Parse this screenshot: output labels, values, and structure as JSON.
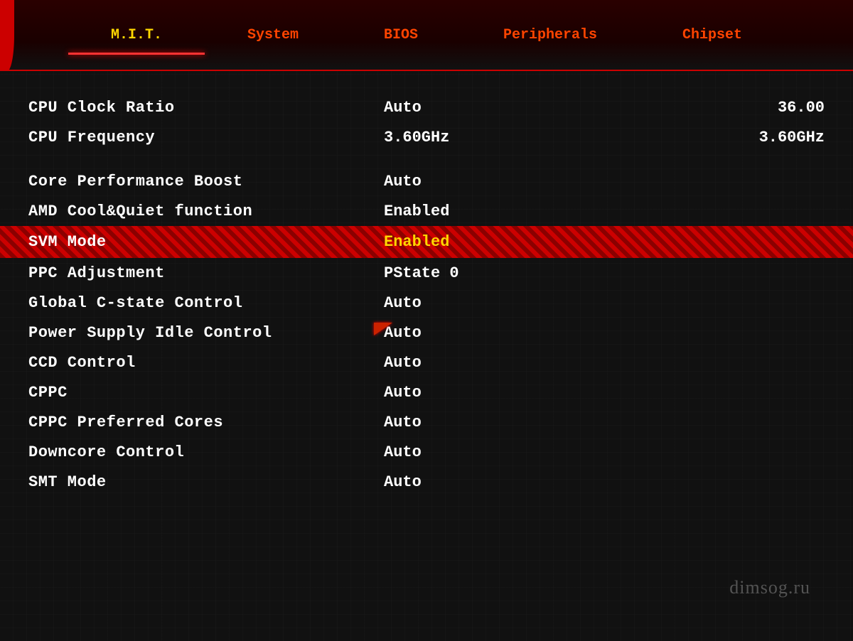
{
  "nav": {
    "tabs": [
      {
        "id": "mit",
        "label": "M.I.T.",
        "active": true
      },
      {
        "id": "system",
        "label": "System",
        "active": false
      },
      {
        "id": "bios",
        "label": "BIOS",
        "active": false
      },
      {
        "id": "peripherals",
        "label": "Peripherals",
        "active": false
      },
      {
        "id": "chipset",
        "label": "Chipset",
        "active": false
      }
    ]
  },
  "settings": [
    {
      "id": "cpu-clock-ratio",
      "name": "CPU Clock Ratio",
      "value": "Auto",
      "value2": "36.00",
      "highlighted": false
    },
    {
      "id": "cpu-frequency",
      "name": "CPU Frequency",
      "value": "3.60GHz",
      "value2": "3.60GHz",
      "highlighted": false
    },
    {
      "id": "core-performance-boost",
      "name": "Core Performance Boost",
      "value": "Auto",
      "value2": "",
      "highlighted": false
    },
    {
      "id": "amd-cool-quiet",
      "name": "AMD Cool&Quiet function",
      "value": "Enabled",
      "value2": "",
      "highlighted": false
    },
    {
      "id": "svm-mode",
      "name": "SVM Mode",
      "value": "Enabled",
      "value2": "",
      "highlighted": true
    },
    {
      "id": "ppc-adjustment",
      "name": "PPC Adjustment",
      "value": "PState 0",
      "value2": "",
      "highlighted": false
    },
    {
      "id": "global-cstate",
      "name": "Global C-state Control",
      "value": "Auto",
      "value2": "",
      "highlighted": false
    },
    {
      "id": "power-supply-idle",
      "name": "Power Supply Idle Control",
      "value": "Auto",
      "value2": "",
      "highlighted": false
    },
    {
      "id": "ccd-control",
      "name": "CCD Control",
      "value": "Auto",
      "value2": "",
      "highlighted": false
    },
    {
      "id": "cppc",
      "name": "CPPC",
      "value": "Auto",
      "value2": "",
      "highlighted": false
    },
    {
      "id": "cppc-preferred-cores",
      "name": "CPPC Preferred Cores",
      "value": "Auto",
      "value2": "",
      "highlighted": false
    },
    {
      "id": "downcore-control",
      "name": "Downcore Control",
      "value": "Auto",
      "value2": "",
      "highlighted": false
    },
    {
      "id": "smt-mode",
      "name": "SMT Mode",
      "value": "Auto",
      "value2": "",
      "highlighted": false
    }
  ],
  "watermark": "dimsog.ru"
}
